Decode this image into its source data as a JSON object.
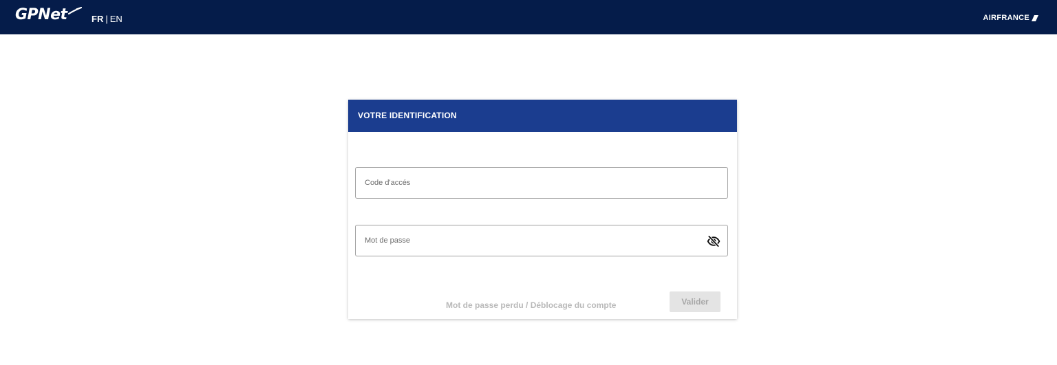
{
  "header": {
    "logo_text": "GPNet",
    "lang_fr": "FR",
    "lang_separator": "|",
    "lang_en": "EN",
    "brand_text": "AIRFRANCE",
    "background_color": "#051c4a"
  },
  "login": {
    "title": "VOTRE IDENTIFICATION",
    "header_color": "#1b3d8f",
    "access_code": {
      "placeholder": "Code d'accés",
      "value": ""
    },
    "password": {
      "placeholder": "Mot de passe",
      "value": "",
      "toggle_icon": "eye-off-icon"
    },
    "forgot_link": "Mot de passe perdu / Déblocage du compte",
    "submit_label": "Valider"
  }
}
